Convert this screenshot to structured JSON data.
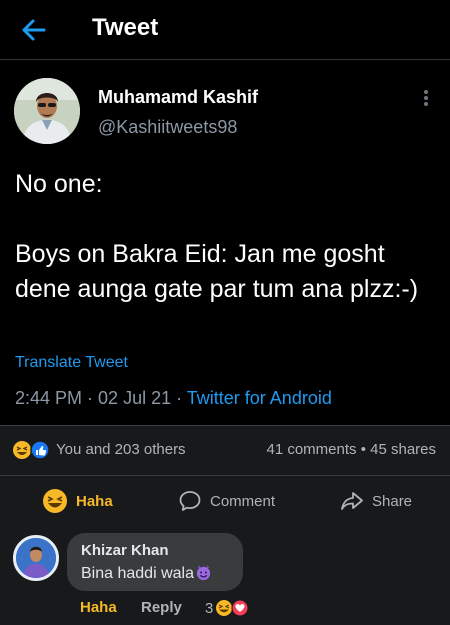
{
  "header": {
    "title": "Tweet",
    "back_icon": "arrow-left-icon"
  },
  "tweet": {
    "author_name": "Muhamamd Kashif",
    "author_handle": "@Kashiitweets98",
    "text": "No one:\n\nBoys on Bakra Eid: Jan me gosht dene aunga gate par tum ana plzz:-)",
    "translate_label": "Translate Tweet",
    "time": "2:44 PM",
    "date": "02 Jul 21",
    "client": "Twitter for Android",
    "separator": " · "
  },
  "post_stats": {
    "reactions_text": "You and 203 others",
    "comments": "41 comments",
    "shares": "45 shares",
    "dot": " • "
  },
  "actions": {
    "haha_label": "Haha",
    "comment_label": "Comment",
    "share_label": "Share"
  },
  "comment": {
    "author": "Khizar Khan",
    "text": "Bina haddi wala",
    "haha_label": "Haha",
    "reply_label": "Reply",
    "reaction_count": "3"
  },
  "colors": {
    "accent_blue": "#1d9bf0",
    "haha_yellow": "#f7b928",
    "muted": "#8b98a5"
  }
}
